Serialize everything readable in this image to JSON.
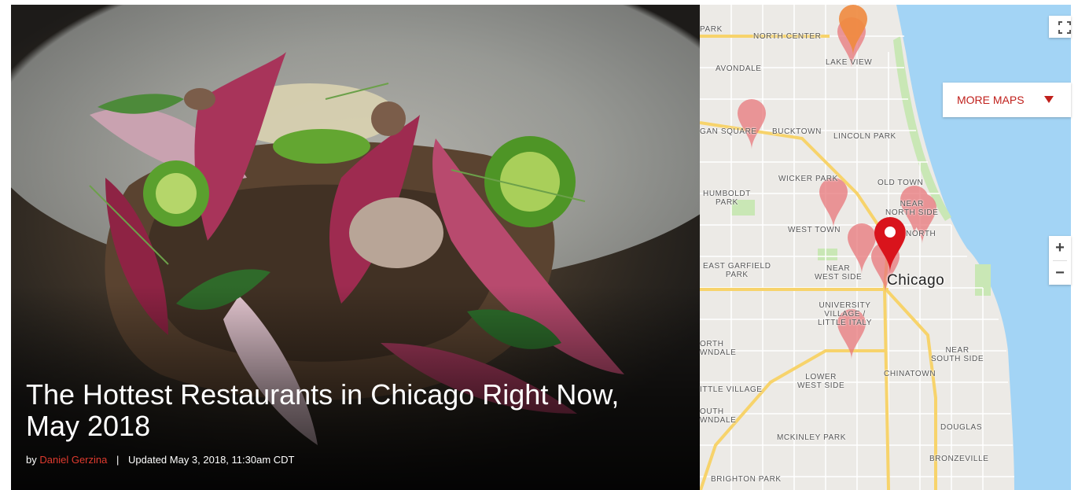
{
  "hero": {
    "title": "The Hottest Restaurants in Chicago Right Now, May 2018",
    "byline_prefix": "by",
    "author": "Daniel Gerzina",
    "separator": "|",
    "updated": "Updated May 3, 2018, 11:30am CDT"
  },
  "map": {
    "city_label": "Chicago",
    "neighborhoods": {
      "park": "PARK",
      "north_center": "NORTH CENTER",
      "lake_view": "LAKE VIEW",
      "avondale": "AVONDALE",
      "logan_square": "GAN SQUARE",
      "bucktown": "BUCKTOWN",
      "lincoln_park": "LINCOLN PARK",
      "wicker_park": "WICKER PARK",
      "old_town": "OLD TOWN",
      "humboldt_park": "HUMBOLDT\nPARK",
      "near_north_side": "NEAR\nNORTH SIDE",
      "west_town": "WEST TOWN",
      "north": "NORTH",
      "east_garfield_park": "EAST GARFIELD\nPARK",
      "near_west_side": "NEAR\nWEST SIDE",
      "university_village": "UNIVERSITY\nVILLAGE /\nLITTLE ITALY",
      "north_lawndale": "ORTH\nWNDALE",
      "near_south_side": "NEAR\nSOUTH SIDE",
      "chinatown": "CHINATOWN",
      "lower_west_side": "LOWER\nWEST SIDE",
      "little_village": "ITTLE VILLAGE",
      "south_lawndale": "OUTH\nWNDALE",
      "douglas": "DOUGLAS",
      "mckinley_park": "MCKINLEY PARK",
      "bronzeville": "BRONZEVILLE",
      "brighton_park": "BRIGHTON PARK"
    },
    "more_maps_label": "MORE MAPS",
    "zoom_in": "+",
    "zoom_out": "−"
  },
  "colors": {
    "accent": "#c0201c",
    "marker_faded": "#e8777b",
    "marker_active": "#d9141c",
    "marker_orange": "#f08a3e",
    "water": "#a3d4f5",
    "park": "#c9e7b5",
    "highway": "#f7d36b"
  }
}
